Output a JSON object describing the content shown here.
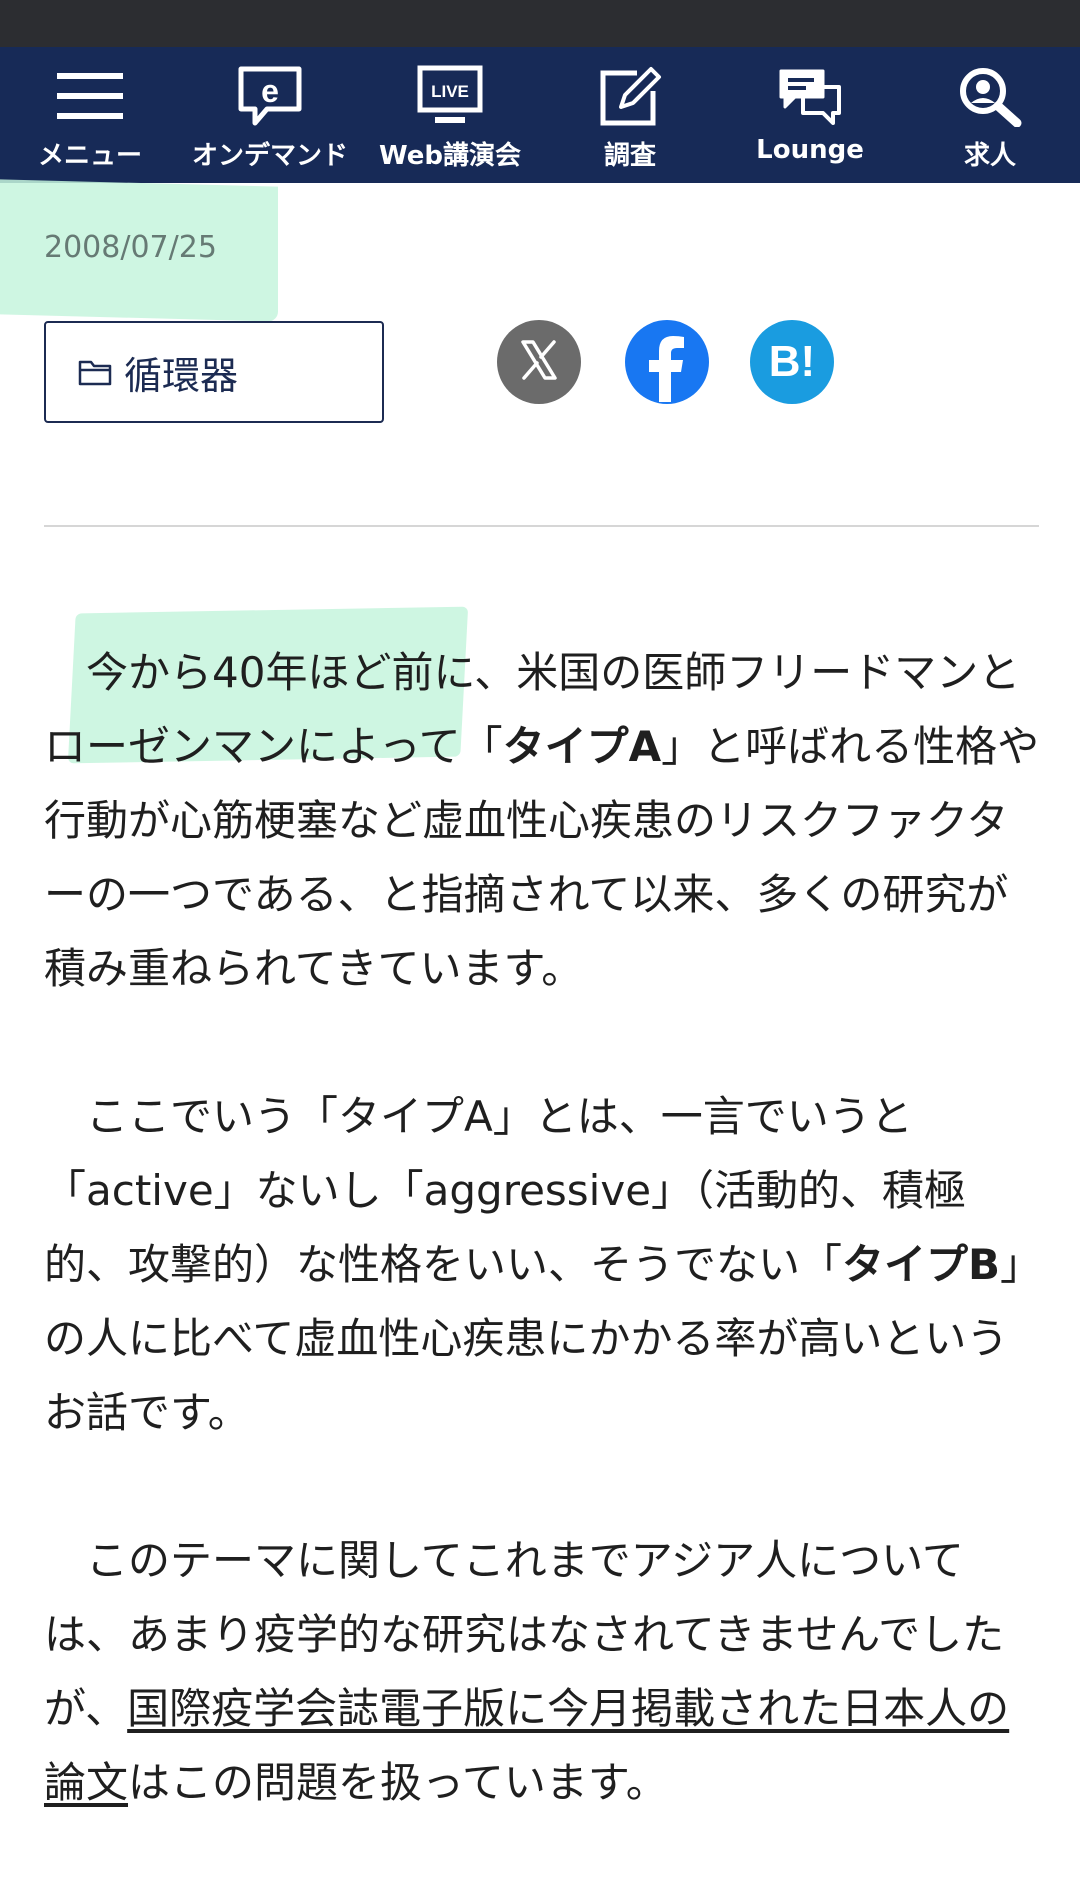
{
  "nav": {
    "items": [
      {
        "label": "メニュー",
        "icon": "hamburger-menu-icon"
      },
      {
        "label": "オンデマンド",
        "icon": "e-speech-bubble-icon"
      },
      {
        "label": "Web講演会",
        "icon": "live-monitor-icon",
        "badge": "LIVE"
      },
      {
        "label": "調査",
        "icon": "edit-pencil-icon"
      },
      {
        "label": "Lounge",
        "icon": "chat-bubbles-icon"
      },
      {
        "label": "求人",
        "icon": "search-icon"
      }
    ]
  },
  "article": {
    "date": "2008/07/25",
    "category": "循環器",
    "share": {
      "hatena_label": "B!",
      "icons": [
        "x-icon",
        "facebook-icon",
        "hatena-bookmark-icon"
      ]
    },
    "paragraphs": {
      "p1": {
        "t1": "今から40年ほど前に、米国の医師フリードマンとローゼンマンによって「",
        "b1": "タイプA",
        "t2": "」と呼ばれる性格や行動が心筋梗塞など虚血性心疾患のリスクファクターの一つである、と指摘されて以来、多くの研究が積み重ねられてきています。"
      },
      "p2": {
        "t1": "ここでいう「タイプA」とは、一言でいうと「active」ないし「aggressive」（活動的、積極的、攻撃的）な性格をいい、そうでない「",
        "b1": "タイプB",
        "t2": "」の人に比べて虚血性心疾患にかかる率が高いというお話です。"
      },
      "p3": {
        "t1": "このテーマに関してこれまでアジア人については、あまり疫学的な研究はなされてきませんでしたが、",
        "link": "国際疫学会誌電子版に今月掲載された日本人の論文",
        "t2": "はこの問題を扱っています。"
      }
    }
  },
  "colors": {
    "status_bar": "#2c2d31",
    "nav_bg": "#172a57",
    "highlight": "#c5f5dd",
    "facebook": "#1877f2",
    "hatena": "#1a9ce0",
    "x_button": "#6b6b6b"
  }
}
